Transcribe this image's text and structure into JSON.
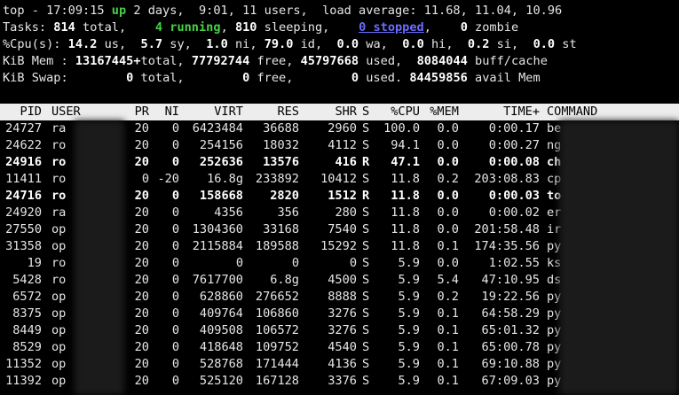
{
  "summary": {
    "line1": {
      "prefix": "top - 17:09:15 ",
      "up": "up",
      "rest": " 2 days,  9:01, 11 users,  load average: 11.68, 11.04, 10.96"
    },
    "line2": {
      "label": "Tasks: ",
      "total": "814",
      "total_label": " total,    ",
      "running": "4 running",
      "sleeping": "810",
      "sleeping_label": " sleeping,    ",
      "stopped": "0 stopped",
      "stopped_label": ",",
      "zombie": "0",
      "zombie_label": " zombie"
    },
    "line3": [
      "%Cpu(s): ",
      "14.2",
      " us,  ",
      "5.7",
      " sy,  ",
      "1.0",
      " ni, ",
      "79.0",
      " id,  ",
      "0.0",
      " wa,  ",
      "0.0",
      " hi,  ",
      "0.2",
      " si,  ",
      "0.0",
      " st"
    ],
    "line4": [
      "KiB Mem : ",
      "13167445+",
      "total, ",
      "77792744",
      " free, ",
      "45797668",
      " used,  ",
      "8084044",
      " buff/cache"
    ],
    "line5": [
      "KiB Swap:        ",
      "0",
      " total,        ",
      "0",
      " free,        ",
      "0",
      " used. ",
      "84459856",
      " avail Mem"
    ]
  },
  "columns": [
    "PID",
    "USER",
    "PR",
    "NI",
    "VIRT",
    "RES",
    "SHR",
    "S",
    "%CPU",
    "%MEM",
    "TIME+",
    "COMMAND"
  ],
  "processes": [
    {
      "pid": "24727",
      "user": "ra",
      "pr": "20",
      "ni": "0",
      "virt": "6423484",
      "res": "36688",
      "shr": "2960",
      "s": "S",
      "cpu": "100.0",
      "mem": "0.0",
      "time": "0:00.17",
      "cmd": "be",
      "bold": false
    },
    {
      "pid": "24622",
      "user": "ro",
      "pr": "20",
      "ni": "0",
      "virt": "254156",
      "res": "18032",
      "shr": "4112",
      "s": "S",
      "cpu": "94.1",
      "mem": "0.0",
      "time": "0:00.27",
      "cmd": "ng",
      "bold": false
    },
    {
      "pid": "24916",
      "user": "ro",
      "pr": "20",
      "ni": "0",
      "virt": "252636",
      "res": "13576",
      "shr": "416",
      "s": "R",
      "cpu": "47.1",
      "mem": "0.0",
      "time": "0:00.08",
      "cmd": "ch",
      "bold": true
    },
    {
      "pid": "11411",
      "user": "ro",
      "pr": "0",
      "ni": "-20",
      "virt": "16.8g",
      "res": "233892",
      "shr": "10412",
      "s": "S",
      "cpu": "11.8",
      "mem": "0.2",
      "time": "203:08.83",
      "cmd": "cp",
      "bold": false
    },
    {
      "pid": "24716",
      "user": "ro",
      "pr": "20",
      "ni": "0",
      "virt": "158668",
      "res": "2820",
      "shr": "1512",
      "s": "R",
      "cpu": "11.8",
      "mem": "0.0",
      "time": "0:00.03",
      "cmd": "to",
      "bold": true
    },
    {
      "pid": "24920",
      "user": "ra",
      "pr": "20",
      "ni": "0",
      "virt": "4356",
      "res": "356",
      "shr": "280",
      "s": "S",
      "cpu": "11.8",
      "mem": "0.0",
      "time": "0:00.02",
      "cmd": "er",
      "bold": false
    },
    {
      "pid": "27550",
      "user": "op",
      "pr": "20",
      "ni": "0",
      "virt": "1304360",
      "res": "33168",
      "shr": "7540",
      "s": "S",
      "cpu": "11.8",
      "mem": "0.0",
      "time": "201:58.48",
      "cmd": "ir",
      "bold": false
    },
    {
      "pid": "31358",
      "user": "op",
      "pr": "20",
      "ni": "0",
      "virt": "2115884",
      "res": "189588",
      "shr": "15292",
      "s": "S",
      "cpu": "11.8",
      "mem": "0.1",
      "time": "174:35.56",
      "cmd": "py",
      "bold": false
    },
    {
      "pid": "19",
      "user": "ro",
      "pr": "20",
      "ni": "0",
      "virt": "0",
      "res": "0",
      "shr": "0",
      "s": "S",
      "cpu": "5.9",
      "mem": "0.0",
      "time": "1:02.55",
      "cmd": "ks",
      "bold": false
    },
    {
      "pid": "5428",
      "user": "ro",
      "pr": "20",
      "ni": "0",
      "virt": "7617700",
      "res": "6.8g",
      "shr": "4500",
      "s": "S",
      "cpu": "5.9",
      "mem": "5.4",
      "time": "47:10.95",
      "cmd": "ds",
      "bold": false
    },
    {
      "pid": "6572",
      "user": "op",
      "pr": "20",
      "ni": "0",
      "virt": "628860",
      "res": "276652",
      "shr": "8888",
      "s": "S",
      "cpu": "5.9",
      "mem": "0.2",
      "time": "19:22.56",
      "cmd": "py",
      "bold": false
    },
    {
      "pid": "8375",
      "user": "op",
      "pr": "20",
      "ni": "0",
      "virt": "409764",
      "res": "106860",
      "shr": "3276",
      "s": "S",
      "cpu": "5.9",
      "mem": "0.1",
      "time": "64:58.29",
      "cmd": "py",
      "bold": false
    },
    {
      "pid": "8449",
      "user": "op",
      "pr": "20",
      "ni": "0",
      "virt": "409508",
      "res": "106572",
      "shr": "3276",
      "s": "S",
      "cpu": "5.9",
      "mem": "0.1",
      "time": "65:01.32",
      "cmd": "py",
      "bold": false
    },
    {
      "pid": "8529",
      "user": "op",
      "pr": "20",
      "ni": "0",
      "virt": "418648",
      "res": "109752",
      "shr": "4540",
      "s": "S",
      "cpu": "5.9",
      "mem": "0.1",
      "time": "65:00.78",
      "cmd": "py",
      "bold": false
    },
    {
      "pid": "11352",
      "user": "op",
      "pr": "20",
      "ni": "0",
      "virt": "528768",
      "res": "171444",
      "shr": "4136",
      "s": "S",
      "cpu": "5.9",
      "mem": "0.1",
      "time": "69:10.88",
      "cmd": "py",
      "bold": false
    },
    {
      "pid": "11392",
      "user": "op",
      "pr": "20",
      "ni": "0",
      "virt": "525120",
      "res": "167128",
      "shr": "3376",
      "s": "S",
      "cpu": "5.9",
      "mem": "0.1",
      "time": "67:09.03",
      "cmd": "py",
      "bold": false
    }
  ]
}
